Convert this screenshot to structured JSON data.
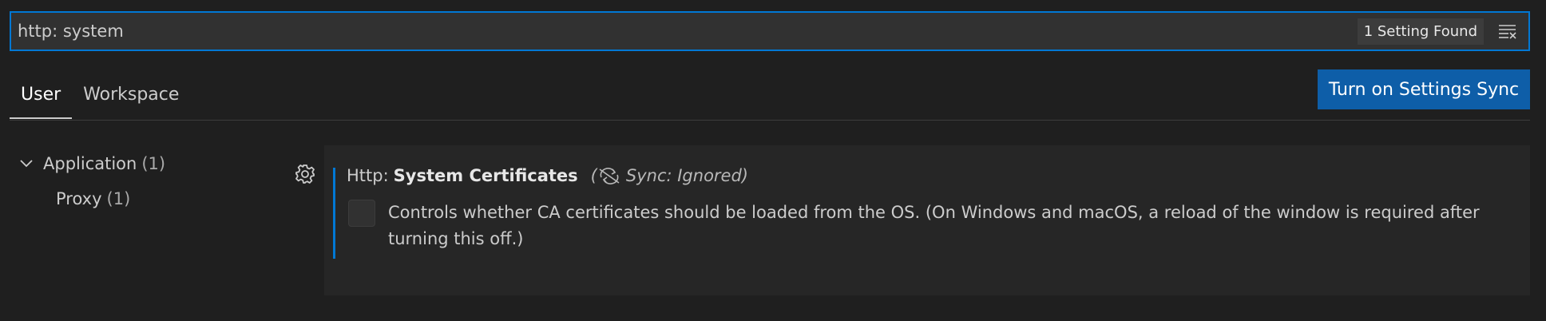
{
  "search": {
    "value": "http: system",
    "result_count": "1 Setting Found"
  },
  "tabs": [
    {
      "label": "User",
      "active": true
    },
    {
      "label": "Workspace",
      "active": false
    }
  ],
  "sync_button": {
    "label": "Turn on Settings Sync"
  },
  "toc": {
    "group": {
      "label": "Application",
      "count": "(1)"
    },
    "child": {
      "label": "Proxy",
      "count": "(1)"
    }
  },
  "setting": {
    "category": "Http:",
    "name": "System Certificates",
    "sync_status": "Sync: Ignored)",
    "sync_prefix": "(",
    "description": "Controls whether CA certificates should be loaded from the OS. (On Windows and macOS, a reload of the window is required after turning this off.)",
    "checked": false
  },
  "colors": {
    "accent": "#0078d4",
    "sync_button": "#0e5ea8",
    "background": "#1f1f1f"
  },
  "icons": {
    "clear_filter": "clear-filter-icon",
    "chevron": "chevron-down-icon",
    "gear": "gear-icon",
    "sync_ignored": "sync-ignored-icon"
  }
}
